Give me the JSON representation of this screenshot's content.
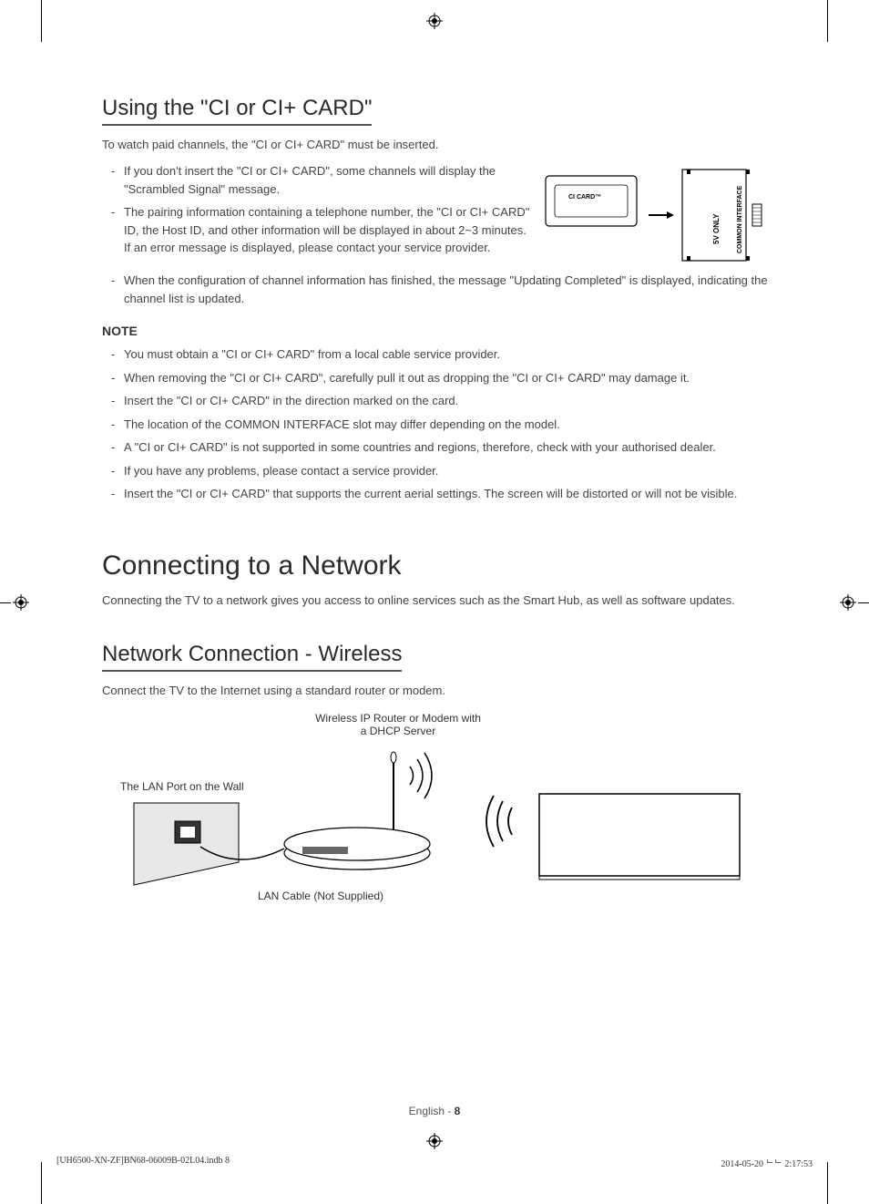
{
  "section1": {
    "title": "Using the \"CI or CI+ CARD\"",
    "intro": "To watch paid channels, the \"CI or CI+ CARD\" must be inserted.",
    "bullets": [
      "If you don't insert the \"CI or CI+ CARD\", some channels will display the \"Scrambled Signal\" message.",
      "The pairing information containing a telephone number, the \"CI or CI+ CARD\" ID, the Host ID, and other information will be displayed in about 2~3 minutes. If an error message is displayed, please contact your service provider.",
      "When the configuration of channel information has finished, the message \"Updating Completed\" is displayed, indicating the channel list is updated."
    ],
    "diagram": {
      "card_label": "CI CARD™",
      "slot_label": "COMMON INTERFACE",
      "voltage_label": "5V ONLY"
    },
    "note_heading": "NOTE",
    "notes": [
      "You must obtain a \"CI or CI+ CARD\" from a local cable service provider.",
      "When removing the \"CI or CI+ CARD\", carefully pull it out as dropping the \"CI or CI+ CARD\" may damage it.",
      "Insert the \"CI or CI+ CARD\" in the direction marked on the card.",
      "The location of the COMMON INTERFACE slot may differ depending on the model.",
      "A \"CI or CI+ CARD\" is not supported in some countries and regions, therefore, check with your authorised dealer.",
      "If you have any problems, please contact a service provider.",
      "Insert the \"CI or CI+ CARD\" that supports the current aerial settings. The screen will be distorted or will not be visible."
    ]
  },
  "section2": {
    "title": "Connecting to a Network",
    "intro": "Connecting the TV to a network gives you access to online services such as the Smart Hub, as well as software updates."
  },
  "section3": {
    "title": "Network Connection - Wireless",
    "intro": "Connect the TV to the Internet using a standard router or modem.",
    "diagram": {
      "router_label_line1": "Wireless IP Router or Modem with",
      "router_label_line2": "a DHCP Server",
      "wall_label": "The LAN Port on the Wall",
      "cable_label": "LAN Cable (Not Supplied)"
    }
  },
  "footer": {
    "page_lang": "English",
    "page_num": "8",
    "print_left": "[UH6500-XN-ZF]BN68-06009B-02L04.indb   8",
    "print_right": "2014-05-20   ᄂᄂ 2:17:53"
  }
}
